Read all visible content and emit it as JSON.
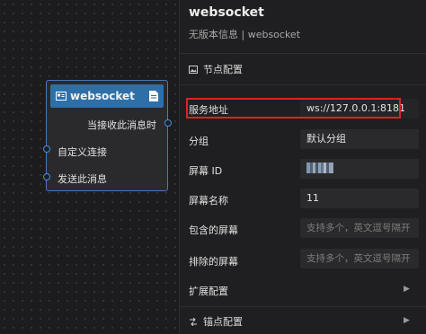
{
  "node": {
    "title": "websocket",
    "output_port": "当接收此消息时",
    "input_ports": [
      "自定义连接",
      "发送此消息"
    ]
  },
  "panel": {
    "title": "websocket",
    "subtitle": "无版本信息 | websocket",
    "sections": {
      "node_config": "节点配置",
      "extend_config": "扩展配置",
      "anchor_config": "锚点配置"
    },
    "fields": {
      "server_address": {
        "label": "服务地址",
        "value": "ws://127.0.0.1:8181"
      },
      "group": {
        "label": "分组",
        "value": "默认分组"
      },
      "screen_id": {
        "label": "屏幕 ID",
        "value": ""
      },
      "screen_name": {
        "label": "屏幕名称",
        "value": "11"
      },
      "included_screens": {
        "label": "包含的屏幕",
        "placeholder": "支持多个，英文逗号隔开"
      },
      "excluded_screens": {
        "label": "排除的屏幕",
        "placeholder": "支持多个，英文逗号隔开"
      }
    }
  },
  "colors": {
    "accent": "#2f6fa8",
    "port": "#4a8ee0",
    "highlight": "#e0202a"
  }
}
